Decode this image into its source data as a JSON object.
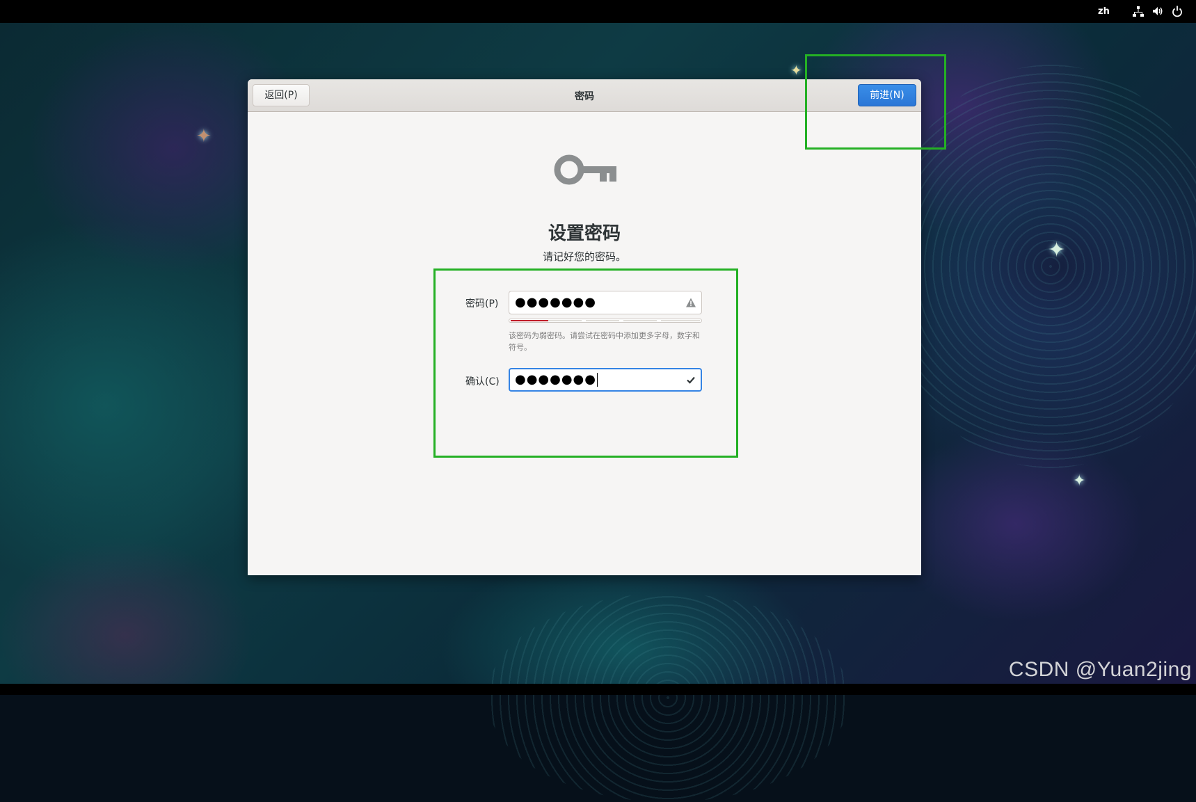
{
  "topbar": {
    "language": "zh",
    "icons": [
      "network-icon",
      "volume-icon",
      "power-icon"
    ]
  },
  "dialog": {
    "back_label": "返回(P)",
    "title": "密码",
    "next_label": "前进(N)",
    "page_title": "设置密码",
    "page_subtitle": "请记好您的密码。",
    "password_label": "密码(P)",
    "password_value": "●●●●●●●",
    "password_strength": 0.2,
    "password_hint": "该密码为弱密码。请尝试在密码中添加更多字母，数字和符号。",
    "confirm_label": "确认(C)",
    "confirm_value": "●●●●●●●"
  },
  "watermark": "CSDN @Yuan2jing",
  "colors": {
    "accent": "#3584e4",
    "weak_strength": "#c01c28",
    "annotation_box": "#24b024"
  }
}
